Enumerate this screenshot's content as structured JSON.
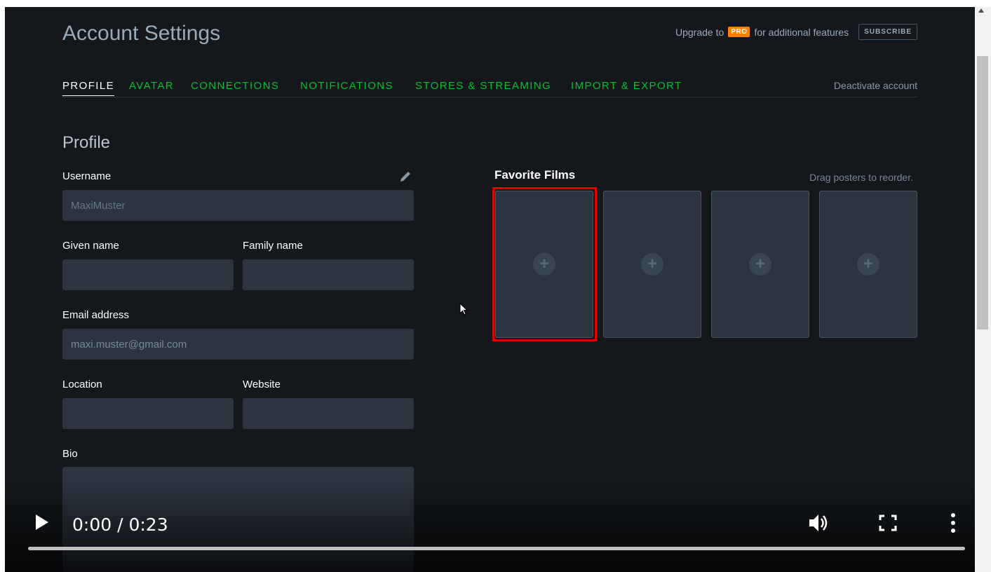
{
  "header": {
    "title": "Account Settings",
    "upgrade_prefix": "Upgrade to",
    "pro_badge": "PRO",
    "upgrade_suffix": "for additional features",
    "subscribe_label": "SUBSCRIBE"
  },
  "tabs": [
    {
      "label": "PROFILE",
      "active": true
    },
    {
      "label": "AVATAR"
    },
    {
      "label": "CONNECTIONS"
    },
    {
      "label": "NOTIFICATIONS"
    },
    {
      "label": "STORES & STREAMING"
    },
    {
      "label": "IMPORT & EXPORT"
    }
  ],
  "deactivate_label": "Deactivate account",
  "profile": {
    "section_title": "Profile",
    "username_label": "Username",
    "username_value": "MaxiMuster",
    "given_name_label": "Given name",
    "given_name_value": "",
    "family_name_label": "Family name",
    "family_name_value": "",
    "email_label": "Email address",
    "email_value": "maxi.muster@gmail.com",
    "location_label": "Location",
    "location_value": "",
    "website_label": "Website",
    "website_value": "",
    "bio_label": "Bio",
    "bio_value": ""
  },
  "favorite_films": {
    "title": "Favorite Films",
    "hint": "Drag posters to reorder.",
    "slot_symbol": "+"
  },
  "player": {
    "time": "0:00 / 0:23"
  },
  "colors": {
    "background": "#14181c",
    "tab_green": "#00c030",
    "pro_orange": "#ff8000",
    "highlight_red": "#e00000"
  }
}
